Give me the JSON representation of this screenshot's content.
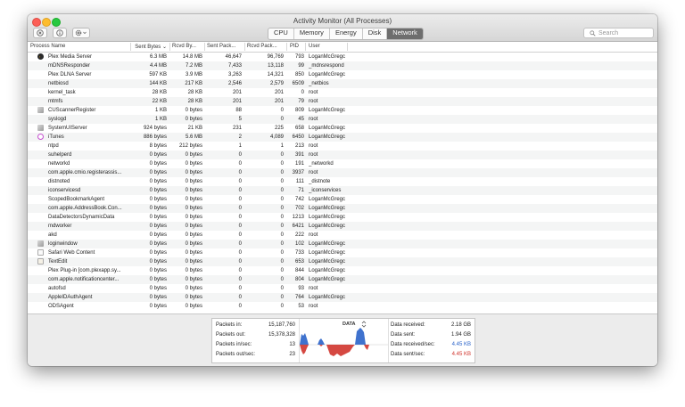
{
  "window": {
    "title": "Activity Monitor (All Processes)",
    "tabs": [
      "CPU",
      "Memory",
      "Energy",
      "Disk",
      "Network"
    ],
    "active_tab": "Network",
    "search_placeholder": "Search"
  },
  "columns": [
    "Process Name",
    "Sent Bytes",
    "Rcvd By...",
    "Sent Pack...",
    "Rcvd Pack...",
    "PID",
    "User"
  ],
  "sort_indicator": "⌄",
  "processes": [
    {
      "name": "Plex Media Server",
      "sent": "6.3 MB",
      "rcvd": "14.8 MB",
      "sp": "46,647",
      "rp": "96,769",
      "pid": "793",
      "user": "LoganMcGregc",
      "icon": "plex-icon"
    },
    {
      "name": "mDNSResponder",
      "sent": "4.4 MB",
      "rcvd": "7.2 MB",
      "sp": "7,433",
      "rp": "13,118",
      "pid": "99",
      "user": "_mdnsrespond",
      "icon": ""
    },
    {
      "name": "Plex DLNA Server",
      "sent": "597 KB",
      "rcvd": "3.9 MB",
      "sp": "3,263",
      "rp": "14,321",
      "pid": "850",
      "user": "LoganMcGregc",
      "icon": ""
    },
    {
      "name": "netbiosd",
      "sent": "144 KB",
      "rcvd": "217 KB",
      "sp": "2,546",
      "rp": "2,579",
      "pid": "6509",
      "user": "_netbios",
      "icon": ""
    },
    {
      "name": "kernel_task",
      "sent": "28 KB",
      "rcvd": "28 KB",
      "sp": "201",
      "rp": "201",
      "pid": "0",
      "user": "root",
      "icon": ""
    },
    {
      "name": "mtmfs",
      "sent": "22 KB",
      "rcvd": "28 KB",
      "sp": "201",
      "rp": "201",
      "pid": "79",
      "user": "root",
      "icon": ""
    },
    {
      "name": "CUScannerRegister",
      "sent": "1 KB",
      "rcvd": "0 bytes",
      "sp": "88",
      "rp": "0",
      "pid": "809",
      "user": "LoganMcGregc",
      "icon": "app-icon"
    },
    {
      "name": "syslogd",
      "sent": "1 KB",
      "rcvd": "0 bytes",
      "sp": "5",
      "rp": "0",
      "pid": "45",
      "user": "root",
      "icon": ""
    },
    {
      "name": "SystemUIServer",
      "sent": "924 bytes",
      "rcvd": "21 KB",
      "sp": "231",
      "rp": "225",
      "pid": "658",
      "user": "LoganMcGregc",
      "icon": "app-icon"
    },
    {
      "name": "iTunes",
      "sent": "886 bytes",
      "rcvd": "5.6 MB",
      "sp": "2",
      "rp": "4,089",
      "pid": "6450",
      "user": "LoganMcGregc",
      "icon": "itunes-icon"
    },
    {
      "name": "ntpd",
      "sent": "8 bytes",
      "rcvd": "212 bytes",
      "sp": "1",
      "rp": "1",
      "pid": "213",
      "user": "root",
      "icon": ""
    },
    {
      "name": "suhelperd",
      "sent": "0 bytes",
      "rcvd": "0 bytes",
      "sp": "0",
      "rp": "0",
      "pid": "391",
      "user": "root",
      "icon": ""
    },
    {
      "name": "networkd",
      "sent": "0 bytes",
      "rcvd": "0 bytes",
      "sp": "0",
      "rp": "0",
      "pid": "191",
      "user": "_networkd",
      "icon": ""
    },
    {
      "name": "com.apple.cmio.registerassis...",
      "sent": "0 bytes",
      "rcvd": "0 bytes",
      "sp": "0",
      "rp": "0",
      "pid": "3937",
      "user": "root",
      "icon": ""
    },
    {
      "name": "distnoted",
      "sent": "0 bytes",
      "rcvd": "0 bytes",
      "sp": "0",
      "rp": "0",
      "pid": "111",
      "user": "_distnote",
      "icon": ""
    },
    {
      "name": "iconservicesd",
      "sent": "0 bytes",
      "rcvd": "0 bytes",
      "sp": "0",
      "rp": "0",
      "pid": "71",
      "user": "_iconservices",
      "icon": ""
    },
    {
      "name": "ScopedBookmarkAgent",
      "sent": "0 bytes",
      "rcvd": "0 bytes",
      "sp": "0",
      "rp": "0",
      "pid": "742",
      "user": "LoganMcGregc",
      "icon": ""
    },
    {
      "name": "com.apple.AddressBook.Con...",
      "sent": "0 bytes",
      "rcvd": "0 bytes",
      "sp": "0",
      "rp": "0",
      "pid": "702",
      "user": "LoganMcGregc",
      "icon": ""
    },
    {
      "name": "DataDetectorsDynamicData",
      "sent": "0 bytes",
      "rcvd": "0 bytes",
      "sp": "0",
      "rp": "0",
      "pid": "1213",
      "user": "LoganMcGregc",
      "icon": ""
    },
    {
      "name": "mdworker",
      "sent": "0 bytes",
      "rcvd": "0 bytes",
      "sp": "0",
      "rp": "0",
      "pid": "6421",
      "user": "LoganMcGregc",
      "icon": ""
    },
    {
      "name": "akd",
      "sent": "0 bytes",
      "rcvd": "0 bytes",
      "sp": "0",
      "rp": "0",
      "pid": "222",
      "user": "root",
      "icon": ""
    },
    {
      "name": "loginwindow",
      "sent": "0 bytes",
      "rcvd": "0 bytes",
      "sp": "0",
      "rp": "0",
      "pid": "102",
      "user": "LoganMcGregc",
      "icon": "app-icon"
    },
    {
      "name": "Safari Web Content",
      "sent": "0 bytes",
      "rcvd": "0 bytes",
      "sp": "0",
      "rp": "0",
      "pid": "733",
      "user": "LoganMcGregc",
      "icon": "doc-icon"
    },
    {
      "name": "TextEdit",
      "sent": "0 bytes",
      "rcvd": "0 bytes",
      "sp": "0",
      "rp": "0",
      "pid": "653",
      "user": "LoganMcGregc",
      "icon": "textedit-icon"
    },
    {
      "name": "Plex Plug-in [com.plexapp.sy...",
      "sent": "0 bytes",
      "rcvd": "0 bytes",
      "sp": "0",
      "rp": "0",
      "pid": "844",
      "user": "LoganMcGregc",
      "icon": ""
    },
    {
      "name": "com.apple.notificationcenter...",
      "sent": "0 bytes",
      "rcvd": "0 bytes",
      "sp": "0",
      "rp": "0",
      "pid": "804",
      "user": "LoganMcGregc",
      "icon": ""
    },
    {
      "name": "autofsd",
      "sent": "0 bytes",
      "rcvd": "0 bytes",
      "sp": "0",
      "rp": "0",
      "pid": "93",
      "user": "root",
      "icon": ""
    },
    {
      "name": "AppleIDAuthAgent",
      "sent": "0 bytes",
      "rcvd": "0 bytes",
      "sp": "0",
      "rp": "0",
      "pid": "764",
      "user": "LoganMcGregc",
      "icon": ""
    },
    {
      "name": "ODSAgent",
      "sent": "0 bytes",
      "rcvd": "0 bytes",
      "sp": "0",
      "rp": "0",
      "pid": "53",
      "user": "root",
      "icon": ""
    }
  ],
  "stats": {
    "left": [
      {
        "label": "Packets in:",
        "value": "15,187,760"
      },
      {
        "label": "Packets out:",
        "value": "15,378,328"
      },
      {
        "label": "Packets in/sec:",
        "value": "13"
      },
      {
        "label": "Packets out/sec:",
        "value": "23"
      }
    ],
    "graph_label": "DATA",
    "right": [
      {
        "label": "Data received:",
        "value": "2.18 GB",
        "color": "#222222"
      },
      {
        "label": "Data sent:",
        "value": "1.94 GB",
        "color": "#222222"
      },
      {
        "label": "Data received/sec:",
        "value": "4.45 KB",
        "color": "#2a63c9"
      },
      {
        "label": "Data sent/sec:",
        "value": "4.45 KB",
        "color": "#d0342c"
      }
    ]
  },
  "colors": {
    "received": "#2a63c9",
    "sent": "#d0342c",
    "active_tab": "#6e6e6e"
  }
}
